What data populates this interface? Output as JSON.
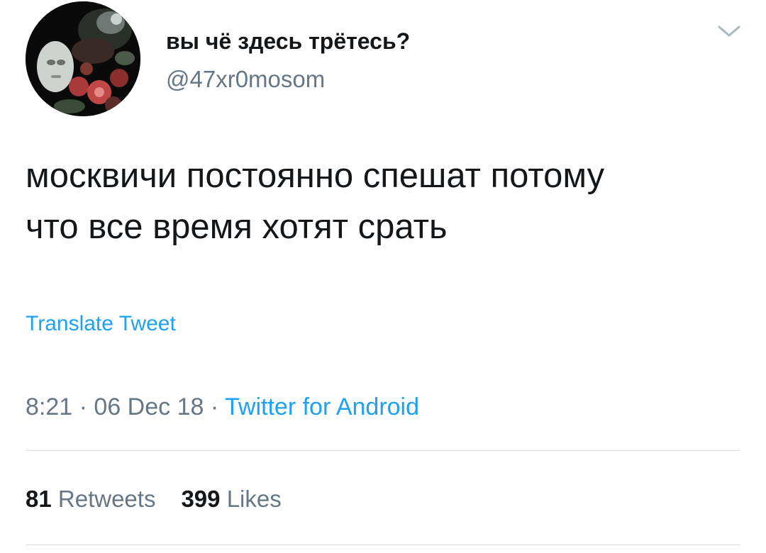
{
  "user": {
    "display_name": "вы чё здесь трётесь?",
    "handle": "@47xr0mosom",
    "avatar_icon": "profile-avatar"
  },
  "tweet": {
    "text_line1": "москвичи постоянно спешат потому",
    "text_line2": "что все время хотят срать"
  },
  "translate_label": "Translate Tweet",
  "meta": {
    "time": "8:21",
    "separator": " · ",
    "date": "06 Dec 18",
    "source": "Twitter for Android"
  },
  "stats": {
    "retweets_count": "81",
    "retweets_label": "Retweets",
    "likes_count": "399",
    "likes_label": "Likes"
  },
  "colors": {
    "link": "#1da1f2",
    "secondary_text": "#657786",
    "primary_text": "#14171a",
    "divider": "#d7dde2"
  },
  "icons": {
    "menu": "chevron-down-icon"
  }
}
